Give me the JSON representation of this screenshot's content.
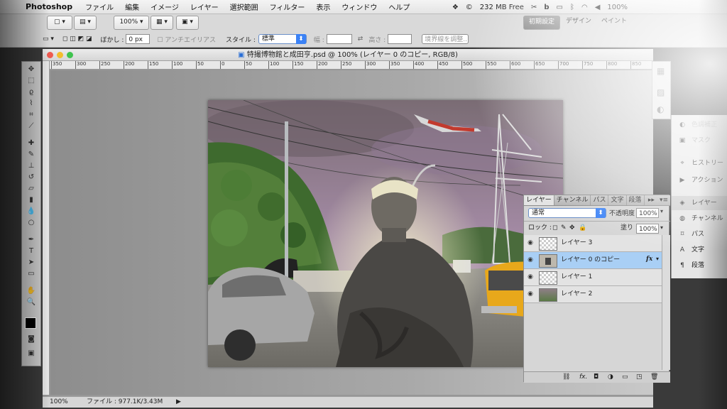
{
  "menubar": {
    "app_name": "Photoshop",
    "items": [
      "ファイル",
      "編集",
      "イメージ",
      "レイヤー",
      "選択範囲",
      "フィルター",
      "表示",
      "ウィンドウ",
      "ヘルプ"
    ],
    "memory": "232 MB Free",
    "battery": "100%"
  },
  "optionsbar": {
    "zoom": "100%",
    "feather_label": "ぼかし :",
    "feather_value": "0 px",
    "antialias_label": "アンチエイリアス",
    "style_label": "スタイル :",
    "style_value": "標準",
    "width_label": "幅 :",
    "height_label": "高さ :",
    "refine_edge": "境界線を調整...",
    "workspace_essentials": "初期設定",
    "workspace_design": "デザイン",
    "workspace_paint": "ペイント"
  },
  "document": {
    "title": "特撮博物館と成田亨.psd @ 100% (レイヤー 0 のコピー, RGB/8)",
    "ruler_top_labels": [
      "350",
      "300",
      "250",
      "200",
      "150",
      "100",
      "50",
      "0",
      "50",
      "100",
      "150",
      "200",
      "250",
      "300",
      "350",
      "400",
      "450",
      "500",
      "550",
      "600",
      "650",
      "700",
      "750",
      "800",
      "850"
    ],
    "status_zoom": "100%",
    "status_file": "ファイル : 977.1K/3.43M"
  },
  "layers_panel": {
    "tabs": [
      "レイヤー",
      "チャンネル",
      "パス",
      "文字",
      "段落"
    ],
    "blend_mode": "通常",
    "opacity_label": "不透明度 :",
    "opacity_value": "100%",
    "lock_label": "ロック :",
    "fill_label": "塗り :",
    "fill_value": "100%",
    "layers": [
      {
        "name": "レイヤー 3"
      },
      {
        "name": "レイヤー 0 のコピー",
        "fx": "fx"
      },
      {
        "name": "レイヤー 1"
      },
      {
        "name": "レイヤー 2"
      }
    ]
  },
  "dock": {
    "items": [
      "色調補正",
      "マスク",
      "ヒストリー",
      "アクション",
      "レイヤー",
      "チャンネル",
      "パス",
      "文字",
      "段落"
    ]
  }
}
